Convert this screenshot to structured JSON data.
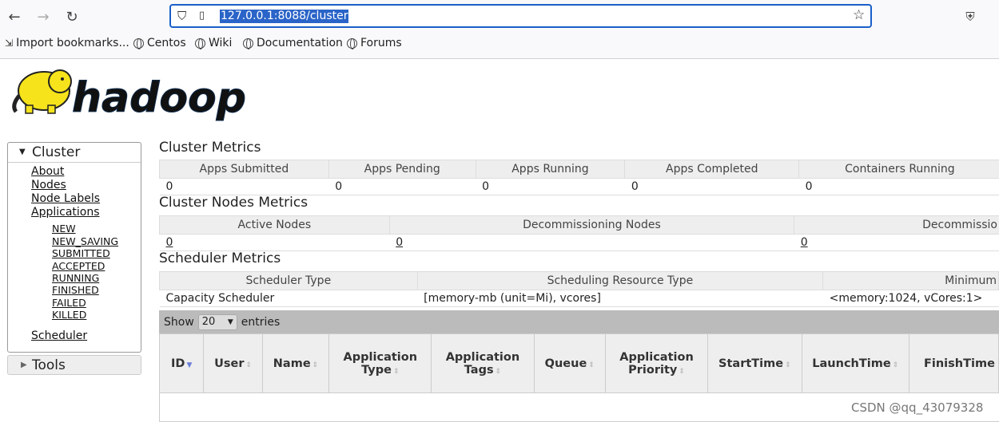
{
  "browser": {
    "url": "127.0.0.1:8088/cluster",
    "bookmarks": [
      "Import bookmarks...",
      "Centos",
      "Wiki",
      "Documentation",
      "Forums"
    ]
  },
  "logo_text": "hadoop",
  "sidebar": {
    "cluster_title": "Cluster",
    "links": [
      "About",
      "Nodes",
      "Node Labels",
      "Applications"
    ],
    "app_states": [
      "NEW",
      "NEW_SAVING",
      "SUBMITTED",
      "ACCEPTED",
      "RUNNING",
      "FINISHED",
      "FAILED",
      "KILLED"
    ],
    "scheduler": "Scheduler",
    "tools_title": "Tools"
  },
  "cluster_metrics": {
    "title": "Cluster Metrics",
    "headers": [
      "Apps Submitted",
      "Apps Pending",
      "Apps Running",
      "Apps Completed",
      "Containers Running"
    ],
    "values": [
      "0",
      "0",
      "0",
      "0",
      "0"
    ]
  },
  "node_metrics": {
    "title": "Cluster Nodes Metrics",
    "headers": [
      "Active Nodes",
      "Decommissioning Nodes",
      "Decommissio"
    ],
    "values": [
      "0",
      "0",
      "0"
    ]
  },
  "scheduler_metrics": {
    "title": "Scheduler Metrics",
    "headers": [
      "Scheduler Type",
      "Scheduling Resource Type",
      "Minimum"
    ],
    "values": [
      "Capacity Scheduler",
      "[memory-mb (unit=Mi), vcores]",
      "<memory:1024, vCores:1>"
    ]
  },
  "apps_table": {
    "show_label": "Show",
    "show_value": "20",
    "entries_label": "entries",
    "columns": [
      "ID",
      "User",
      "Name",
      "Application Type",
      "Application Tags",
      "Queue",
      "Application Priority",
      "StartTime",
      "LaunchTime",
      "FinishTime"
    ]
  },
  "watermark": "CSDN @qq_43079328"
}
